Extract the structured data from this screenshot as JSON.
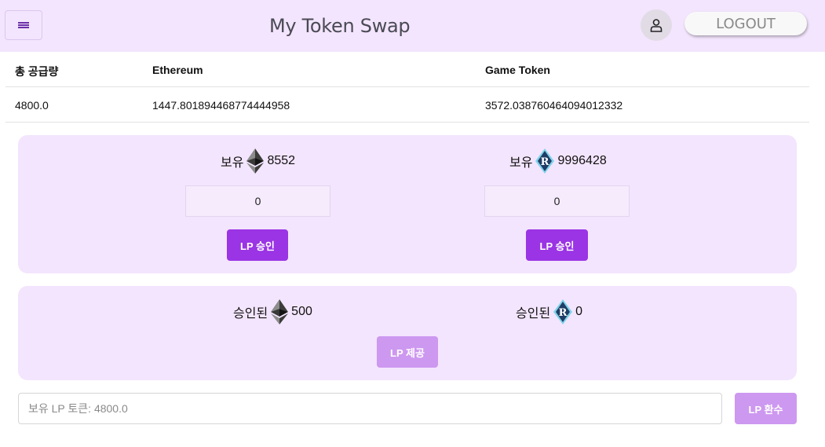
{
  "header": {
    "title": "My Token Swap",
    "logout_label": "LOGOUT"
  },
  "table": {
    "headers": [
      "총 공급량",
      "Ethereum",
      "Game Token"
    ],
    "rows": [
      [
        "4800.0",
        "1447.801894468774444958",
        "3572.038760464094012332"
      ]
    ]
  },
  "holdings": {
    "label": "보유",
    "eth_amount": "8552",
    "game_amount": "9996428"
  },
  "inputs": {
    "eth_value": "0",
    "game_value": "0"
  },
  "approve": {
    "eth_label": "LP 승인",
    "game_label": "LP 승인"
  },
  "approved": {
    "label": "승인된",
    "eth_amount": "500",
    "game_amount": "0",
    "provide_label": "LP 제공"
  },
  "lp": {
    "placeholder": "보유 LP 토큰: 4800.0",
    "swap_label": "LP 환수"
  },
  "icons": {
    "menu": "menu-icon",
    "user": "user-icon",
    "ethereum": "ethereum-icon",
    "game_token": "game-token-icon"
  },
  "colors": {
    "header_bg": "#f3e5fd",
    "panel_bg": "#f3e5fd",
    "accent": "#9a34e4",
    "accent_disabled": "#cd98f0"
  }
}
